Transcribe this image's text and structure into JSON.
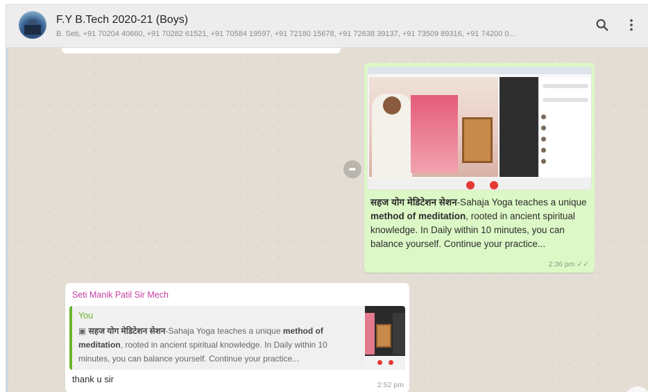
{
  "header": {
    "title": "F.Y B.Tech 2020-21 (Boys)",
    "participants": "B. Seti, +91 70204 40660, +91 70282 61521, +91 70584 19597, +91 72180 15678, +91 72638 39137, +91 73509 89316, +91 74200 0...",
    "icons": {
      "search": "search-icon",
      "menu": "kebab-menu-icon"
    }
  },
  "messages": {
    "outgoing": {
      "text_devanagari": "सहज योग मेडिटेशन सेशन",
      "text_part1": "-Sahaja Yoga teaches a unique ",
      "text_bold": "method of meditation",
      "text_part2": ", rooted in ancient spiritual knowledge. In Daily within 10 minutes, you can balance yourself. Continue your practice...",
      "time": "2:36 pm",
      "status_icon": "double-check-icon"
    },
    "incoming": {
      "sender": "Seti Manik Patil Sir Mech",
      "quoted_author": "You",
      "quoted_devanagari": "सहज योग मेडिटेशन सेशन",
      "quoted_part1": "-Sahaja Yoga teaches a unique ",
      "quoted_bold1": "method of meditation",
      "quoted_part2": ", rooted in ancient spiritual knowledge. In Daily within 10 minutes, you can balance yourself. Continue your practice...",
      "reply": "thank u sir",
      "time": "2:52 pm"
    }
  },
  "colors": {
    "outgoing_bubble": "#dcf8c6",
    "sender_name": "#c63ea0",
    "quote_accent": "#6bb42d",
    "chat_background": "#e3ddd3"
  }
}
